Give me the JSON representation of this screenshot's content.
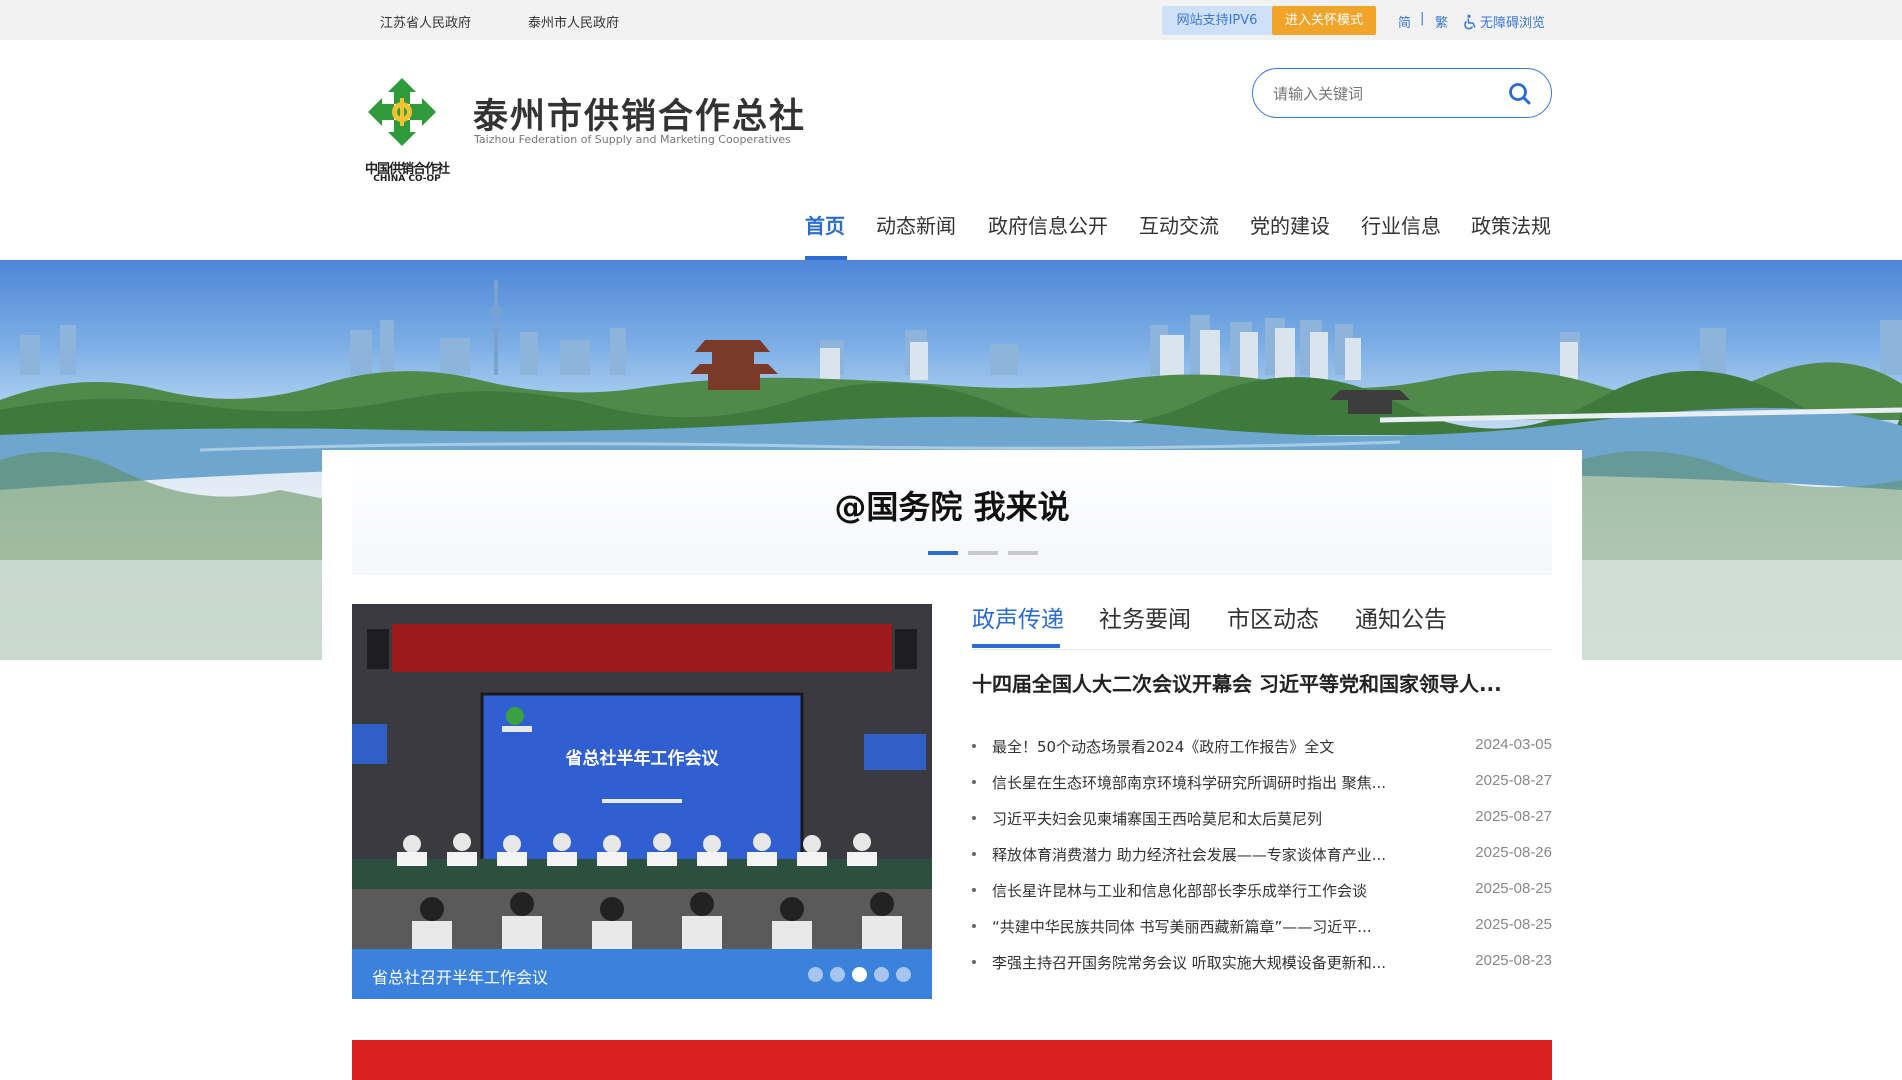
{
  "topbar": {
    "links": [
      "江苏省人民政府",
      "泰州市人民政府"
    ],
    "ipv6_label": "网站支持IPV6",
    "care_mode_label": "进入关怀模式",
    "lang_simplified": "简",
    "lang_traditional": "繁",
    "separator": "|",
    "accessibility_label": "无障碍浏览"
  },
  "header": {
    "logo": {
      "cn": "中国供销合作社",
      "en": "CHINA CO-OP"
    },
    "title": "泰州市供销合作总社",
    "subtitle": "Taizhou Federation of Supply and Marketing Cooperatives",
    "search_placeholder": "请输入关键词"
  },
  "nav": {
    "items": [
      {
        "label": "首页",
        "active": true
      },
      {
        "label": "动态新闻",
        "active": false
      },
      {
        "label": "政府信息公开",
        "active": false
      },
      {
        "label": "互动交流",
        "active": false
      },
      {
        "label": "党的建设",
        "active": false
      },
      {
        "label": "行业信息",
        "active": false
      },
      {
        "label": "政策法规",
        "active": false
      }
    ]
  },
  "headline": {
    "text": "@国务院 我来说",
    "slides": 3,
    "active_slide": 1
  },
  "carousel": {
    "slide_title": "省总社半年工作会议",
    "caption": "省总社召开半年工作会议",
    "dots": 5,
    "active_dot": 3
  },
  "tabs": {
    "items": [
      "政声传递",
      "社务要闻",
      "市区动态",
      "通知公告"
    ],
    "active": 0
  },
  "lead_news": "十四届全国人大二次会议开幕会 习近平等党和国家领导人...",
  "news": [
    {
      "title": "最全！50个动态场景看2024《政府工作报告》全文",
      "date": "2024-03-05"
    },
    {
      "title": "信长星在生态环境部南京环境科学研究所调研时指出 聚焦...",
      "date": "2025-08-27"
    },
    {
      "title": "习近平夫妇会见柬埔寨国王西哈莫尼和太后莫尼列",
      "date": "2025-08-27"
    },
    {
      "title": "释放体育消费潜力 助力经济社会发展——专家谈体育产业...",
      "date": "2025-08-26"
    },
    {
      "title": "信长星许昆林与工业和信息化部部长李乐成举行工作会谈",
      "date": "2025-08-25"
    },
    {
      "title": "“共建中华民族共同体 书写美丽西藏新篇章”——习近平...",
      "date": "2025-08-25"
    },
    {
      "title": "李强主持召开国务院常务会议 听取实施大规模设备更新和...",
      "date": "2025-08-23"
    }
  ],
  "colors": {
    "primary_blue": "#2b6cd0",
    "care_orange": "#f0a52a",
    "caption_blue": "#3a82dc",
    "banner_red": "#d9201f",
    "logo_green": "#2f9a3c"
  },
  "icons": {
    "search": "search-icon",
    "accessibility": "wheelchair-icon",
    "logo": "co-op-emblem-icon"
  }
}
